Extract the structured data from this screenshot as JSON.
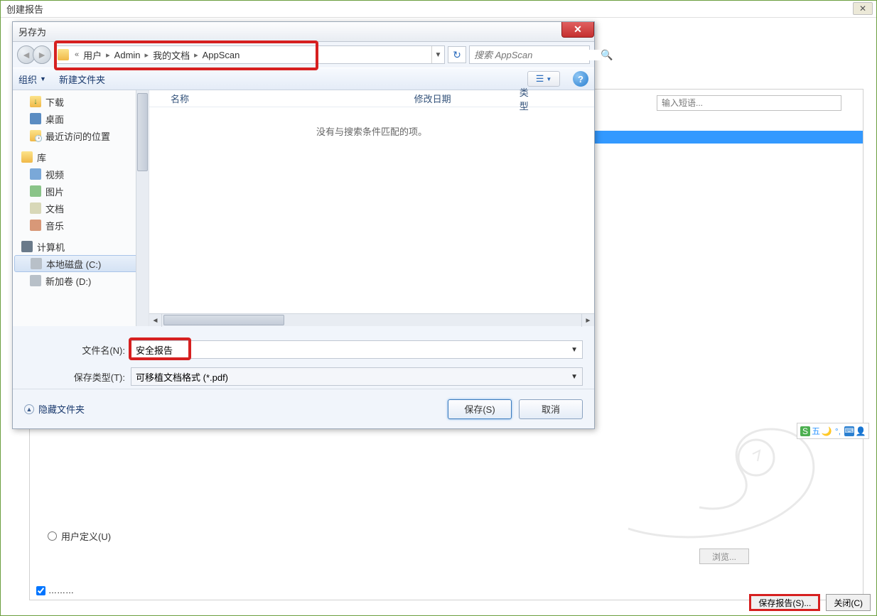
{
  "parent": {
    "title": "创建报告",
    "search_placeholder": "输入短语...",
    "user_defined_label": "用户定义(U)",
    "browse_label": "浏览...",
    "save_report_label": "保存报告(S)...",
    "close_label": "关闭(C)"
  },
  "dialog": {
    "title": "另存为",
    "breadcrumb": {
      "items": [
        "用户",
        "Admin",
        "我的文档",
        "AppScan"
      ]
    },
    "search_placeholder": "搜索 AppScan",
    "toolbar": {
      "organize": "组织",
      "new_folder": "新建文件夹"
    },
    "tree": {
      "downloads": "下载",
      "desktop": "桌面",
      "recent": "最近访问的位置",
      "libraries": "库",
      "videos": "视频",
      "pictures": "图片",
      "documents": "文档",
      "music": "音乐",
      "computer": "计算机",
      "disk_c": "本地磁盘 (C:)",
      "disk_d": "新加卷 (D:)"
    },
    "columns": {
      "name": "名称",
      "date": "修改日期",
      "type": "类型"
    },
    "empty_msg": "没有与搜索条件匹配的项。",
    "filename_label": "文件名(N):",
    "filename_value": "安全报告",
    "filetype_label": "保存类型(T):",
    "filetype_value": "可移植文档格式 (*.pdf)",
    "hide_folders": "隐藏文件夹",
    "save_btn": "保存(S)",
    "cancel_btn": "取消"
  },
  "ime": {
    "label": "五"
  }
}
